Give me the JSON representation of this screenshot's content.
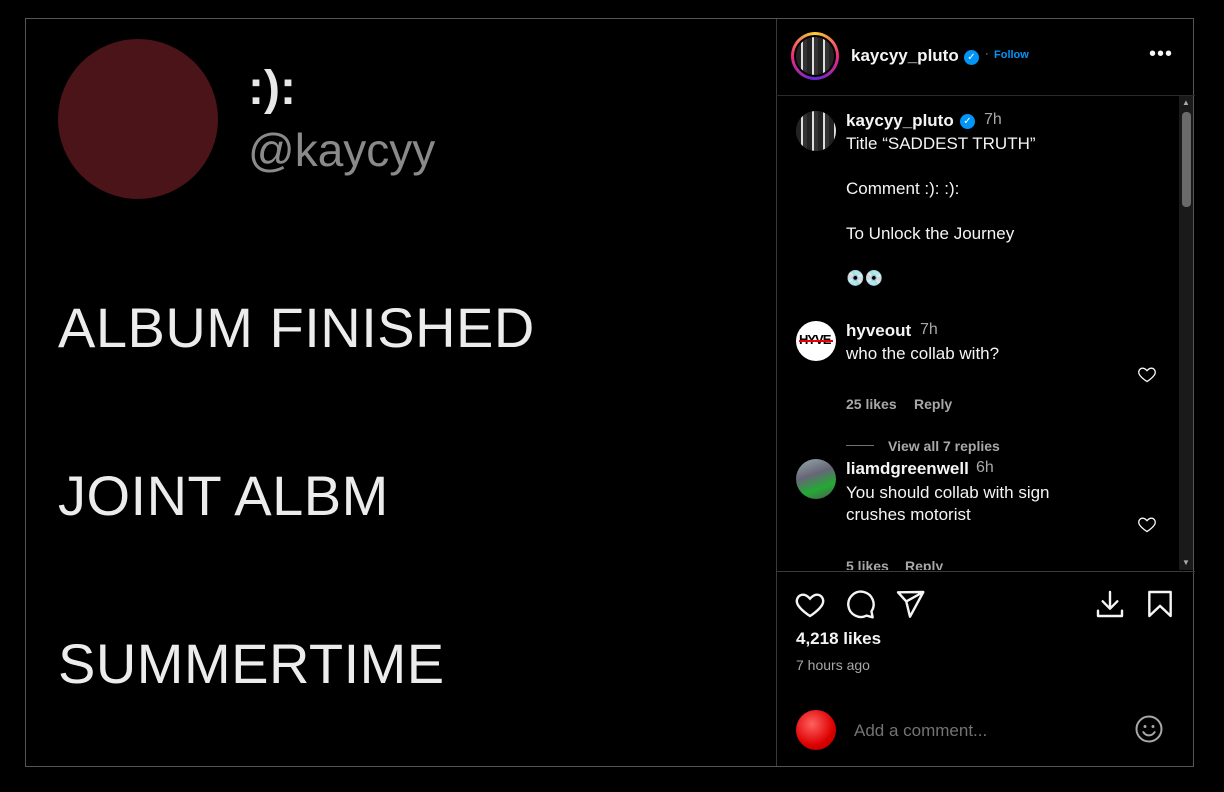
{
  "media": {
    "name": ":):",
    "handle": "@kaycyy",
    "lines": [
      "ALBUM FINISHED",
      "JOINT ALBM",
      "SUMMERTIME"
    ]
  },
  "header": {
    "username": "kaycyy_pluto",
    "dot": "·",
    "follow_label": "Follow",
    "more_label": "•••"
  },
  "caption": {
    "username": "kaycyy_pluto",
    "time": "7h",
    "lines": [
      "Title “SADDEST TRUTH”",
      "",
      "Comment :): :):",
      "",
      "To Unlock the Journey",
      "",
      "💿💿"
    ]
  },
  "comments": [
    {
      "username": "hyveout",
      "time": "7h",
      "text": "who the collab with?",
      "likes": "25 likes",
      "reply_label": "Reply",
      "avatar_text": "HYVE"
    },
    {
      "username": "liamdgreenwell",
      "time": "6h",
      "text_lines": [
        "You should collab with sign",
        "crushes motorist"
      ],
      "likes": "5 likes",
      "reply_label": "Reply"
    }
  ],
  "view_replies_label": "View all 7 replies",
  "stats": {
    "likes": "4,218 likes",
    "time_ago": "7 hours ago"
  },
  "add_comment": {
    "placeholder": "Add a comment..."
  },
  "colors": {
    "accent": "#0095f6",
    "background": "#000000",
    "muted": "#a8a8a8",
    "media_avatar": "#4a1418"
  },
  "icons": [
    "verified-icon",
    "more-icon",
    "heart-icon",
    "comment-icon",
    "share-icon",
    "download-icon",
    "bookmark-icon",
    "emoji-icon"
  ]
}
